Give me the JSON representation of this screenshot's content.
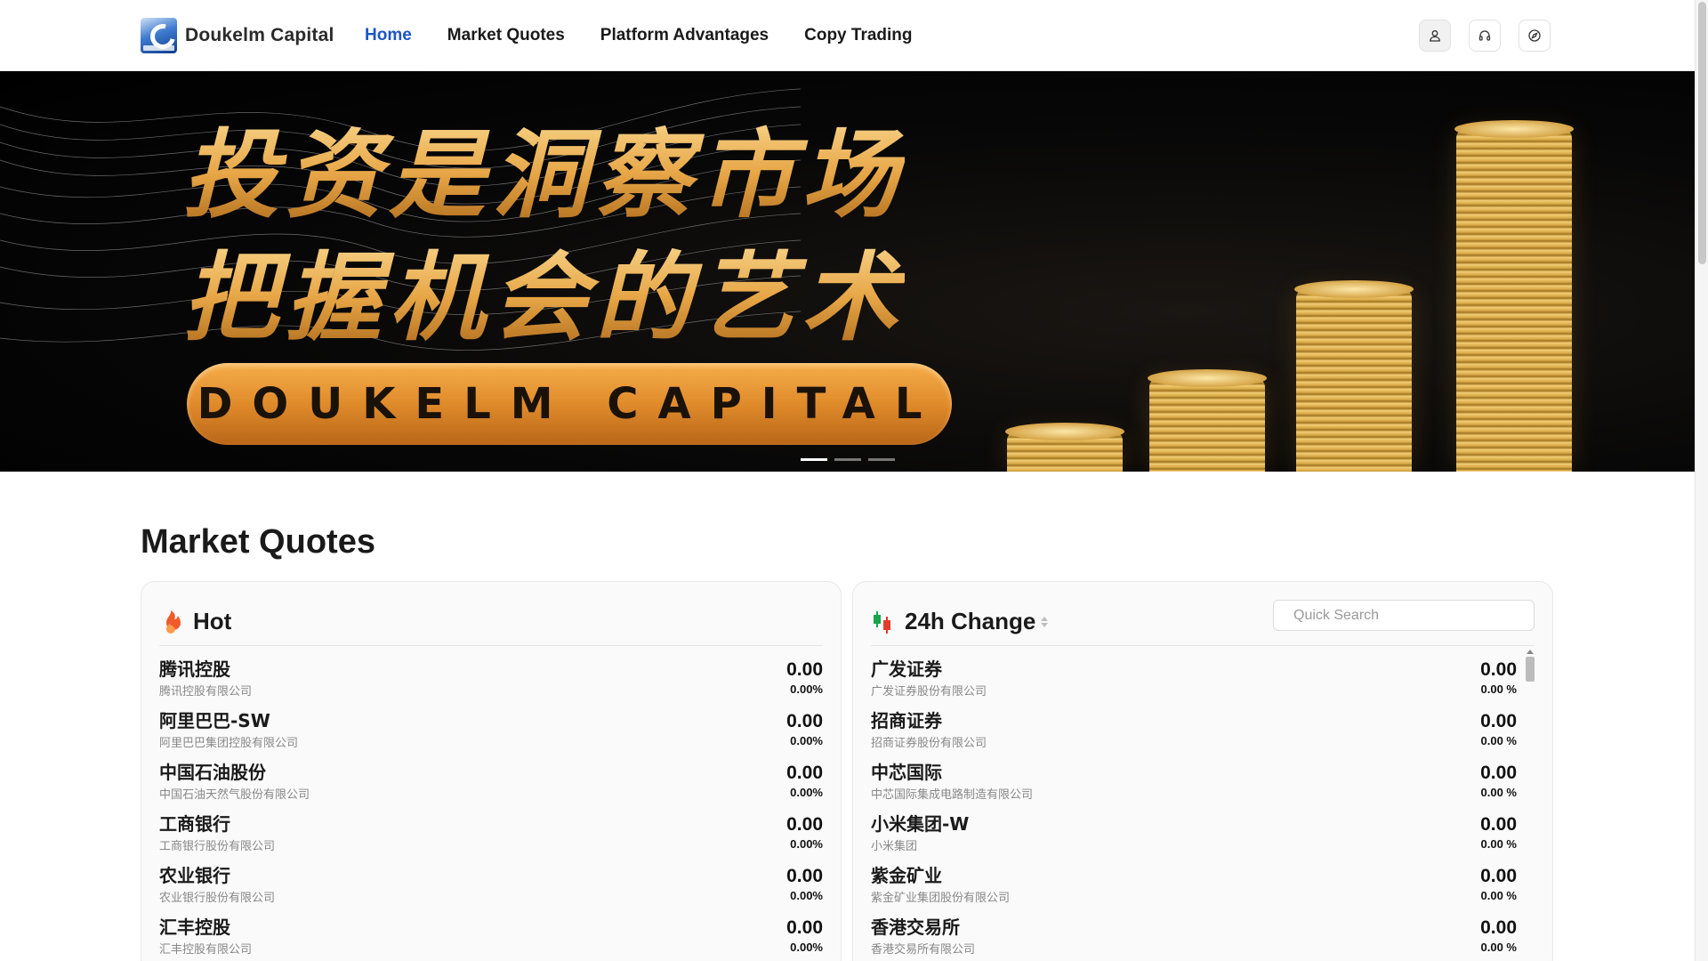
{
  "header": {
    "brand": "Doukelm Capital",
    "nav": [
      {
        "label": "Home",
        "active": true
      },
      {
        "label": "Market Quotes",
        "active": false
      },
      {
        "label": "Platform Advantages",
        "active": false
      },
      {
        "label": "Copy Trading",
        "active": false
      }
    ],
    "icons": [
      "user-icon",
      "headset-icon",
      "compass-icon"
    ],
    "accent_color": "#1c55c7"
  },
  "banner": {
    "line1": "投资是洞察市场",
    "line2": "把握机会的艺术",
    "pill_text": "DOUKELM CAPITAL",
    "slides": 3,
    "active_slide": 1
  },
  "market": {
    "section_title": "Market Quotes",
    "hot": {
      "title": "Hot",
      "icon": "fire-icon",
      "rows": [
        {
          "name": "腾讯控股",
          "full": "腾讯控股有限公司",
          "price": "0.00",
          "change": "0.00%"
        },
        {
          "name": "阿里巴巴-SW",
          "full": "阿里巴巴集团控股有限公司",
          "price": "0.00",
          "change": "0.00%"
        },
        {
          "name": "中国石油股份",
          "full": "中国石油天然气股份有限公司",
          "price": "0.00",
          "change": "0.00%"
        },
        {
          "name": "工商银行",
          "full": "工商银行股份有限公司",
          "price": "0.00",
          "change": "0.00%"
        },
        {
          "name": "农业银行",
          "full": "农业银行股份有限公司",
          "price": "0.00",
          "change": "0.00%"
        },
        {
          "name": "汇丰控股",
          "full": "汇丰控股有限公司",
          "price": "0.00",
          "change": "0.00%"
        }
      ]
    },
    "change24h": {
      "title": "24h Change",
      "icon": "candlestick-icon",
      "search_placeholder": "Quick Search",
      "rows": [
        {
          "name": "广发证券",
          "full": "广发证券股份有限公司",
          "price": "0.00",
          "change": "0.00 %"
        },
        {
          "name": "招商证券",
          "full": "招商证券股份有限公司",
          "price": "0.00",
          "change": "0.00 %"
        },
        {
          "name": "中芯国际",
          "full": "中芯国际集成电路制造有限公司",
          "price": "0.00",
          "change": "0.00 %"
        },
        {
          "name": "小米集团-W",
          "full": "小米集团",
          "price": "0.00",
          "change": "0.00 %"
        },
        {
          "name": "紫金矿业",
          "full": "紫金矿业集团股份有限公司",
          "price": "0.00",
          "change": "0.00 %"
        },
        {
          "name": "香港交易所",
          "full": "香港交易所有限公司",
          "price": "0.00",
          "change": "0.00 %"
        }
      ]
    }
  }
}
